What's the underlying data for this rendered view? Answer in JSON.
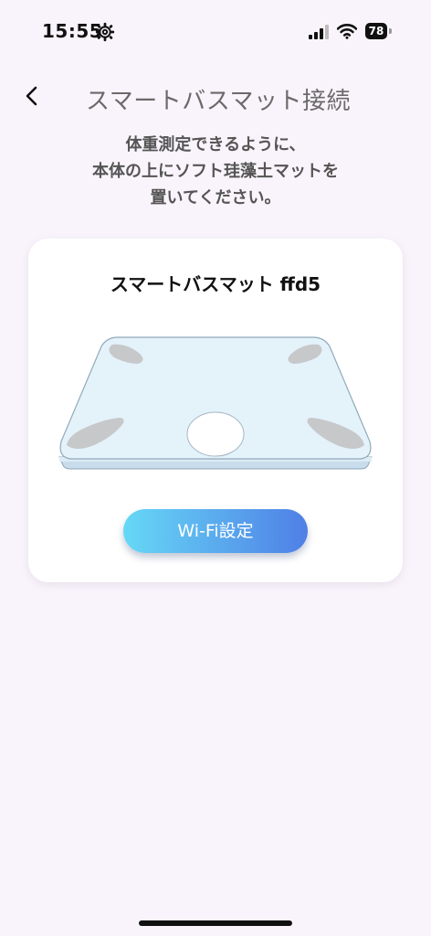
{
  "status_bar": {
    "time": "15:55",
    "battery": "78",
    "icons": [
      "gear-icon",
      "signal-icon",
      "wifi-icon",
      "battery-icon"
    ]
  },
  "header": {
    "title": "スマートバスマット接続",
    "back_icon": "chevron-left-icon"
  },
  "instruction": {
    "lines": [
      "体重測定できるように、",
      "本体の上にソフト珪藻土マットを",
      "置いてください。"
    ]
  },
  "device_card": {
    "device_name": "スマートバスマット ffd5",
    "illustration": "smart-scale-illustration",
    "wifi_button_label": "Wi-Fi設定"
  },
  "colors": {
    "background": "#f9f4fb",
    "card": "#ffffff",
    "button_gradient_start": "#66d8f6",
    "button_gradient_end": "#4f7fe6",
    "scale_top": "#e4f2fa",
    "scale_pads": "#c6c8ca"
  }
}
